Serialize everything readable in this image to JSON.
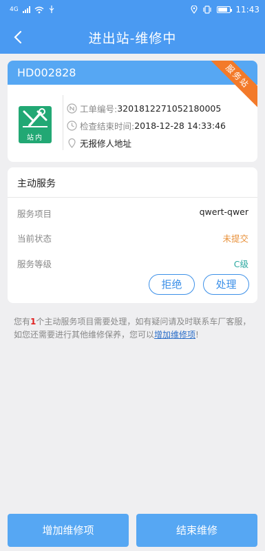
{
  "status": {
    "network": "4G",
    "time": "11:43"
  },
  "nav": {
    "title": "进出站-维修中"
  },
  "order": {
    "id": "HD002828",
    "ribbon": "服务站",
    "logo_label": "站内",
    "number_label": "工单编号:",
    "number_value": "3201812271052180005",
    "check_label": "检查结束时间:",
    "check_value": "2018-12-28 14:33:46",
    "address": "无报修人地址"
  },
  "service": {
    "title": "主动服务",
    "rows": [
      {
        "label": "服务项目",
        "value": "qwert-qwer"
      },
      {
        "label": "当前状态",
        "value": "未提交",
        "color": "#e8913a"
      },
      {
        "label": "服务等级",
        "value": "C级",
        "color": "#2aa8a0"
      }
    ],
    "reject_label": "拒绝",
    "handle_label": "处理"
  },
  "notice": {
    "part1": "您有",
    "count": "1",
    "part2": "个主动服务项目需要处理，如有疑问请及时联系车厂客服，如您还需要进行其他维修保养，您可以",
    "link": "增加维修项",
    "part3": "!"
  },
  "buttons": {
    "add": "增加维修项",
    "end": "结束维修"
  }
}
